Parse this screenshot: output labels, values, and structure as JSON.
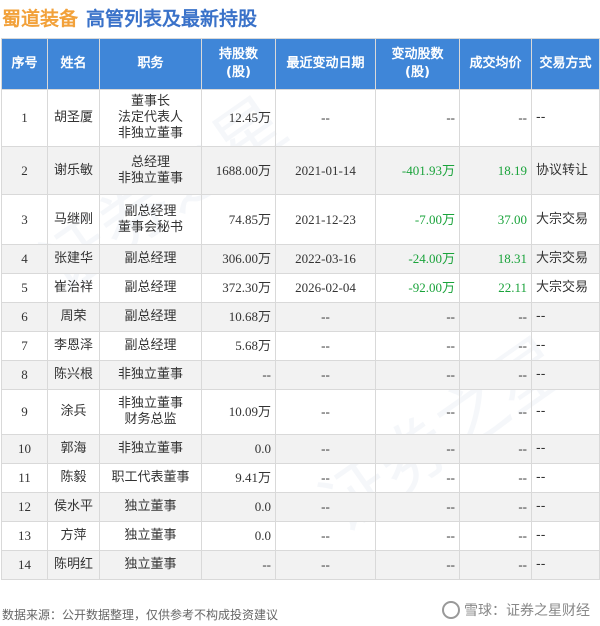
{
  "title": {
    "company": "蜀道装备",
    "subtitle": "高管列表及最新持股"
  },
  "headers": [
    "序号",
    "姓名",
    "职务",
    "持股数\n(股)",
    "最近变动日期",
    "变动股数\n(股)",
    "成交均价",
    "交易方式"
  ],
  "rows": [
    {
      "no": "1",
      "name": "胡圣厦",
      "pos": "董事长\n法定代表人\n非独立董事",
      "hold": "12.45万",
      "date": "--",
      "change": "--",
      "price": "--",
      "mode": "--"
    },
    {
      "no": "2",
      "name": "谢乐敏",
      "pos": "总经理\n非独立董事",
      "hold": "1688.00万",
      "date": "2021-01-14",
      "change": "-401.93万",
      "price": "18.19",
      "mode": "协议转让"
    },
    {
      "no": "3",
      "name": "马继刚",
      "pos": "副总经理\n董事会秘书",
      "hold": "74.85万",
      "date": "2021-12-23",
      "change": "-7.00万",
      "price": "37.00",
      "mode": "大宗交易"
    },
    {
      "no": "4",
      "name": "张建华",
      "pos": "副总经理",
      "hold": "306.00万",
      "date": "2022-03-16",
      "change": "-24.00万",
      "price": "18.31",
      "mode": "大宗交易"
    },
    {
      "no": "5",
      "name": "崔治祥",
      "pos": "副总经理",
      "hold": "372.30万",
      "date": "2026-02-04",
      "change": "-92.00万",
      "price": "22.11",
      "mode": "大宗交易"
    },
    {
      "no": "6",
      "name": "周荣",
      "pos": "副总经理",
      "hold": "10.68万",
      "date": "--",
      "change": "--",
      "price": "--",
      "mode": "--"
    },
    {
      "no": "7",
      "name": "李恩泽",
      "pos": "副总经理",
      "hold": "5.68万",
      "date": "--",
      "change": "--",
      "price": "--",
      "mode": "--"
    },
    {
      "no": "8",
      "name": "陈兴根",
      "pos": "非独立董事",
      "hold": "--",
      "date": "--",
      "change": "--",
      "price": "--",
      "mode": "--"
    },
    {
      "no": "9",
      "name": "涂兵",
      "pos": "非独立董事\n财务总监",
      "hold": "10.09万",
      "date": "--",
      "change": "--",
      "price": "--",
      "mode": "--"
    },
    {
      "no": "10",
      "name": "郭海",
      "pos": "非独立董事",
      "hold": "0.0",
      "date": "--",
      "change": "--",
      "price": "--",
      "mode": "--"
    },
    {
      "no": "11",
      "name": "陈毅",
      "pos": "职工代表董事",
      "hold": "9.41万",
      "date": "--",
      "change": "--",
      "price": "--",
      "mode": "--"
    },
    {
      "no": "12",
      "name": "侯水平",
      "pos": "独立董事",
      "hold": "0.0",
      "date": "--",
      "change": "--",
      "price": "--",
      "mode": "--"
    },
    {
      "no": "13",
      "name": "方萍",
      "pos": "独立董事",
      "hold": "0.0",
      "date": "--",
      "change": "--",
      "price": "--",
      "mode": "--"
    },
    {
      "no": "14",
      "name": "陈明红",
      "pos": "独立董事",
      "hold": "--",
      "date": "--",
      "change": "--",
      "price": "--",
      "mode": "--"
    }
  ],
  "footer": "数据来源：公开数据整理，仅供参考不构成投资建议",
  "brand": "雪球：证券之星财经",
  "watermark": "证券之星",
  "colors": {
    "header_bg": "#3f86d8",
    "company": "#f2a13a",
    "subtitle": "#3a72c9",
    "change_green": "#1aa33b"
  }
}
